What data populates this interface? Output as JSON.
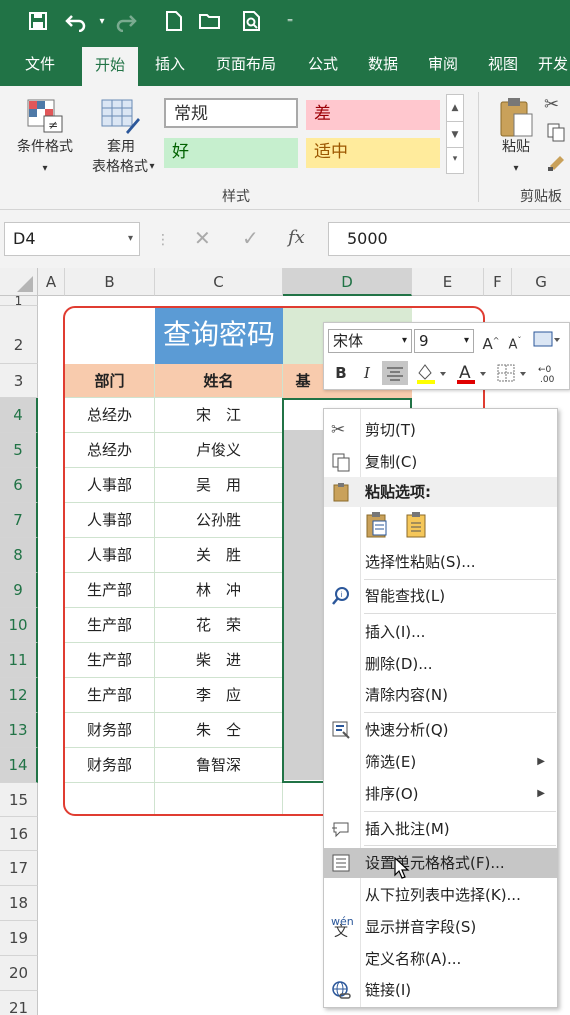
{
  "ribbon": {
    "tabs": [
      "文件",
      "开始",
      "插入",
      "页面布局",
      "公式",
      "数据",
      "审阅",
      "视图",
      "开发"
    ],
    "active_tab": "开始",
    "conditional_format_label": "条件格式",
    "format_as_table_label_1": "套用",
    "format_as_table_label_2": "表格格式",
    "styles": {
      "normal": "常规",
      "bad": "差",
      "good": "好",
      "neutral": "适中"
    },
    "styles_group_label": "样式",
    "paste_label": "粘贴",
    "clipboard_group_label": "剪贴板"
  },
  "formula_bar": {
    "name_box": "D4",
    "fx": "fx",
    "value": "5000"
  },
  "columns": [
    "A",
    "B",
    "C",
    "D",
    "E",
    "F",
    "G"
  ],
  "rows": [
    "1",
    "2",
    "3",
    "4",
    "5",
    "6",
    "7",
    "8",
    "9",
    "10",
    "11",
    "12",
    "13",
    "14",
    "15",
    "16",
    "17",
    "18",
    "19",
    "20",
    "21"
  ],
  "sheet": {
    "title": "查询密码",
    "header_dept": "部门",
    "header_name": "姓名",
    "header_d_partial": "基",
    "records": [
      {
        "dept": "总经办",
        "name": "宋　江"
      },
      {
        "dept": "总经办",
        "name": "卢俊义"
      },
      {
        "dept": "人事部",
        "name": "吴　用"
      },
      {
        "dept": "人事部",
        "name": "公孙胜"
      },
      {
        "dept": "人事部",
        "name": "关　胜"
      },
      {
        "dept": "生产部",
        "name": "林　冲"
      },
      {
        "dept": "生产部",
        "name": "花　荣"
      },
      {
        "dept": "生产部",
        "name": "柴　进"
      },
      {
        "dept": "生产部",
        "name": "李　应"
      },
      {
        "dept": "财务部",
        "name": "朱　仝"
      },
      {
        "dept": "财务部",
        "name": "鲁智深"
      }
    ]
  },
  "mini_toolbar": {
    "font": "宋体",
    "size": "9"
  },
  "context_menu": {
    "cut": "剪切(T)",
    "copy": "复制(C)",
    "paste_options": "粘贴选项:",
    "paste_special": "选择性粘贴(S)...",
    "smart_lookup": "智能查找(L)",
    "insert": "插入(I)...",
    "delete": "删除(D)...",
    "clear": "清除内容(N)",
    "quick_analysis": "快速分析(Q)",
    "filter": "筛选(E)",
    "sort": "排序(O)",
    "insert_comment": "插入批注(M)",
    "format_cells": "设置单元格格式(F)...",
    "pick_from_list": "从下拉列表中选择(K)...",
    "show_phonetic": "显示拼音字段(S)",
    "define_name": "定义名称(A)...",
    "link": "链接(I)"
  },
  "colors": {
    "excel_green": "#217346",
    "title_fill": "#5b9bd5",
    "header_fill": "#f8cbad",
    "selection_gray": "#c6c6c6",
    "border_red": "#e03c31"
  }
}
